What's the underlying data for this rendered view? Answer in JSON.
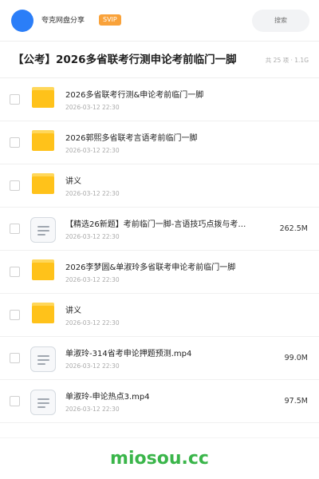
{
  "header": {
    "user_name": "夸克网盘分享",
    "badge": "SVIP",
    "search_placeholder": "搜索"
  },
  "share": {
    "title": "【公考】2026多省联考行测申论考前临门一脚",
    "meta": "共 25 项 · 1.1G"
  },
  "files": [
    {
      "type": "folder",
      "name": "2026多省联考行测&申论考前临门一脚",
      "date": "2026-03-12 22:30",
      "size": ""
    },
    {
      "type": "folder",
      "name": "2026郭熙多省联考言语考前临门一脚",
      "date": "2026-03-12 22:30",
      "size": ""
    },
    {
      "type": "folder",
      "name": "讲义",
      "date": "2026-03-12 22:30",
      "size": ""
    },
    {
      "type": "file",
      "name": "【精选26新题】考前临门一脚-言语技巧点拨与考点预…",
      "date": "2026-03-12 22:30",
      "size": "262.5M"
    },
    {
      "type": "folder",
      "name": "2026李梦圆&单淑玲多省联考申论考前临门一脚",
      "date": "2026-03-12 22:30",
      "size": ""
    },
    {
      "type": "folder",
      "name": "讲义",
      "date": "2026-03-12 22:30",
      "size": ""
    },
    {
      "type": "file",
      "name": "单淑玲-314省考申论押题预测.mp4",
      "date": "2026-03-12 22:30",
      "size": "99.0M"
    },
    {
      "type": "file",
      "name": "单淑玲-申论热点3.mp4",
      "date": "2026-03-12 22:30",
      "size": "97.5M"
    }
  ],
  "watermark": "miosou.cc",
  "colors": {
    "accent": "#2b7ef8",
    "svip": "#f9a23a",
    "folder": "#ffc21a",
    "watermark": "#3ab54a"
  }
}
